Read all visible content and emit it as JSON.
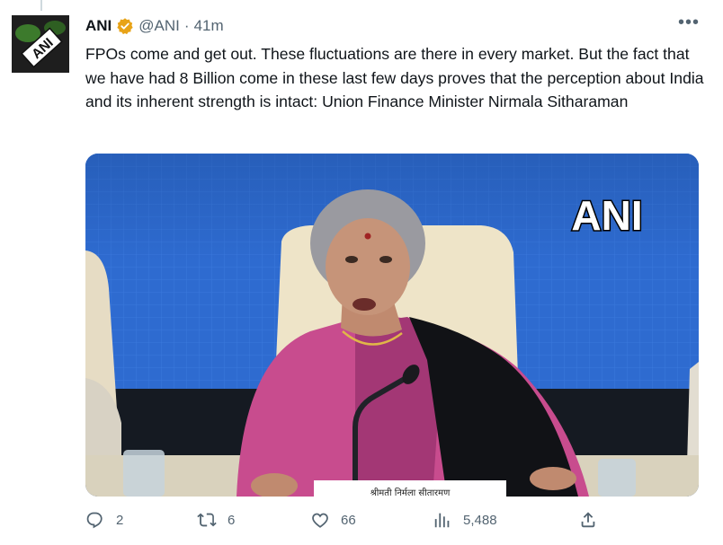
{
  "author": {
    "name": "ANI",
    "handle": "@ANI",
    "separator": "·",
    "time": "41m",
    "avatar_icon": "ani-logo-icon",
    "verified_color": "#e8a317"
  },
  "tweet": {
    "text": "FPOs come and get out. These fluctuations are there in every market. But the fact that we have had 8 Billion come in these last few days proves that the perception about India and its inherent strength is intact: Union Finance Minister Nirmala Sitharaman"
  },
  "media": {
    "watermark": "ANI",
    "nameplate": "श्रीमती निर्मला सीतारमण"
  },
  "actions": {
    "replies": "2",
    "retweets": "6",
    "likes": "66",
    "views": "5,488"
  }
}
